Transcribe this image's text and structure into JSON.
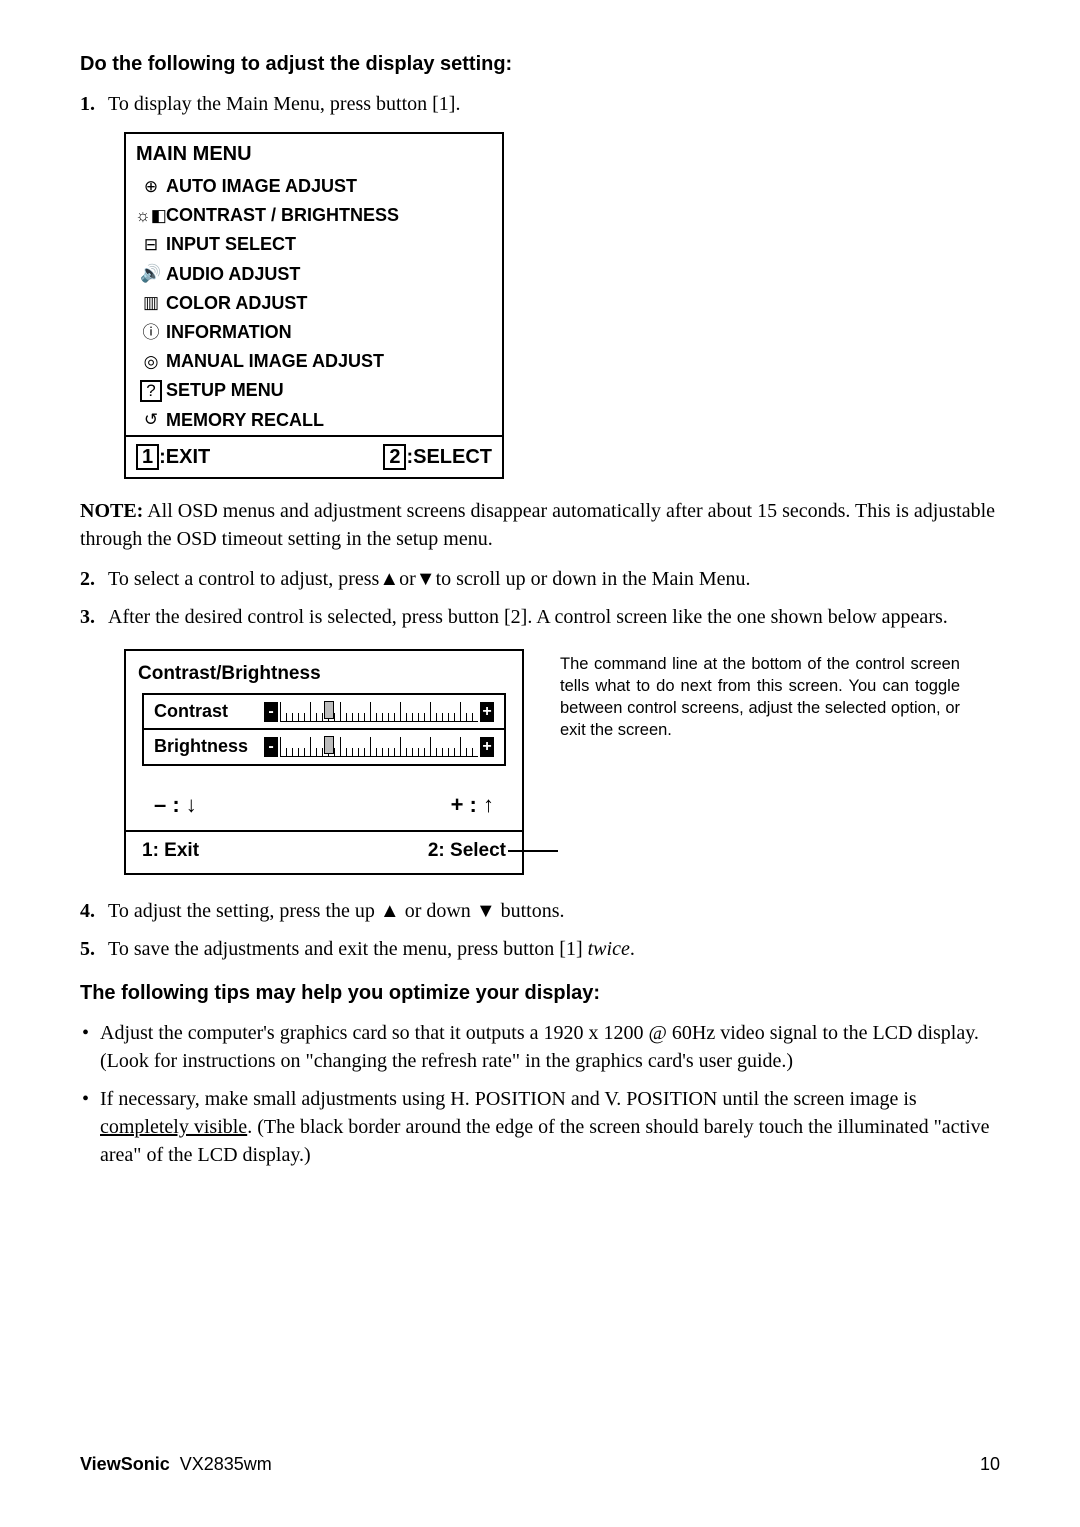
{
  "heading1": "Do the following to adjust the display setting:",
  "step1": {
    "num": "1.",
    "text": "To display the Main Menu, press button [1]."
  },
  "main_menu": {
    "title": "MAIN MENU",
    "items": [
      {
        "icon": "⊕",
        "label": "AUTO IMAGE ADJUST"
      },
      {
        "icon": "☼◧",
        "label": "CONTRAST / BRIGHTNESS"
      },
      {
        "icon": "⊟",
        "label": "INPUT SELECT"
      },
      {
        "icon": "🔊",
        "label": "AUDIO ADJUST"
      },
      {
        "icon": "▥",
        "label": "COLOR ADJUST"
      },
      {
        "icon": "ⓘ",
        "label": "INFORMATION"
      },
      {
        "icon": "◎",
        "label": "MANUAL IMAGE ADJUST"
      },
      {
        "icon": "?",
        "label": "SETUP MENU"
      },
      {
        "icon": "↺",
        "label": "MEMORY RECALL"
      }
    ],
    "footer": {
      "exit_key": "1",
      "exit_label": ":EXIT",
      "select_key": "2",
      "select_label": ":SELECT"
    }
  },
  "note": {
    "bold": "NOTE:",
    "text": " All OSD menus and adjustment screens disappear automatically after about 15 seconds. This is adjustable through the OSD timeout setting in the setup menu."
  },
  "step2": {
    "num": "2.",
    "pre": "To select a control to adjust, press",
    "mid": "or",
    "post": "to scroll up or down in the Main Menu."
  },
  "step3": {
    "num": "3.",
    "text": "After the desired control is selected, press button [2]. A control screen like the one shown below appears."
  },
  "contrast_box": {
    "title": "Contrast/Brightness",
    "row1": "Contrast",
    "row2": "Brightness",
    "minus": "– : ↓",
    "plus": "+ : ↑",
    "exit": "1: Exit",
    "select": "2: Select"
  },
  "sidebar": "The command line at the bottom of the control screen tells what to do next from this screen. You can toggle between control screens, adjust the selected option, or exit the screen.",
  "step4": {
    "num": "4.",
    "pre": "To adjust the setting, press the up ",
    "mid": " or down ",
    "post": " buttons."
  },
  "step5": {
    "num": "5.",
    "pre": "To save the adjustments and exit the menu, press button [1] ",
    "italic": "twice",
    "post": "."
  },
  "heading2": "The following tips may help you optimize your display:",
  "bullets": [
    "Adjust the computer's graphics card so that it outputs a 1920 x 1200 @ 60Hz video signal to the LCD display. (Look for instructions on \"changing the refresh rate\" in the graphics card's user guide.)",
    "If necessary, make small adjustments using H. POSITION and V. POSITION until the screen image is completely visible. (The black border around the edge of the screen should barely touch the illuminated \"active area\" of the LCD display.)"
  ],
  "bullet2_pre": "If necessary, make small adjustments using H. POSITION and V. POSITION until the screen image is ",
  "bullet2_underline": "completely visible",
  "bullet2_post": ". (The black border around the edge of the screen should barely touch the illuminated \"active area\" of the LCD display.)",
  "footer": {
    "brand": "ViewSonic",
    "model": "VX2835wm",
    "page": "10"
  }
}
